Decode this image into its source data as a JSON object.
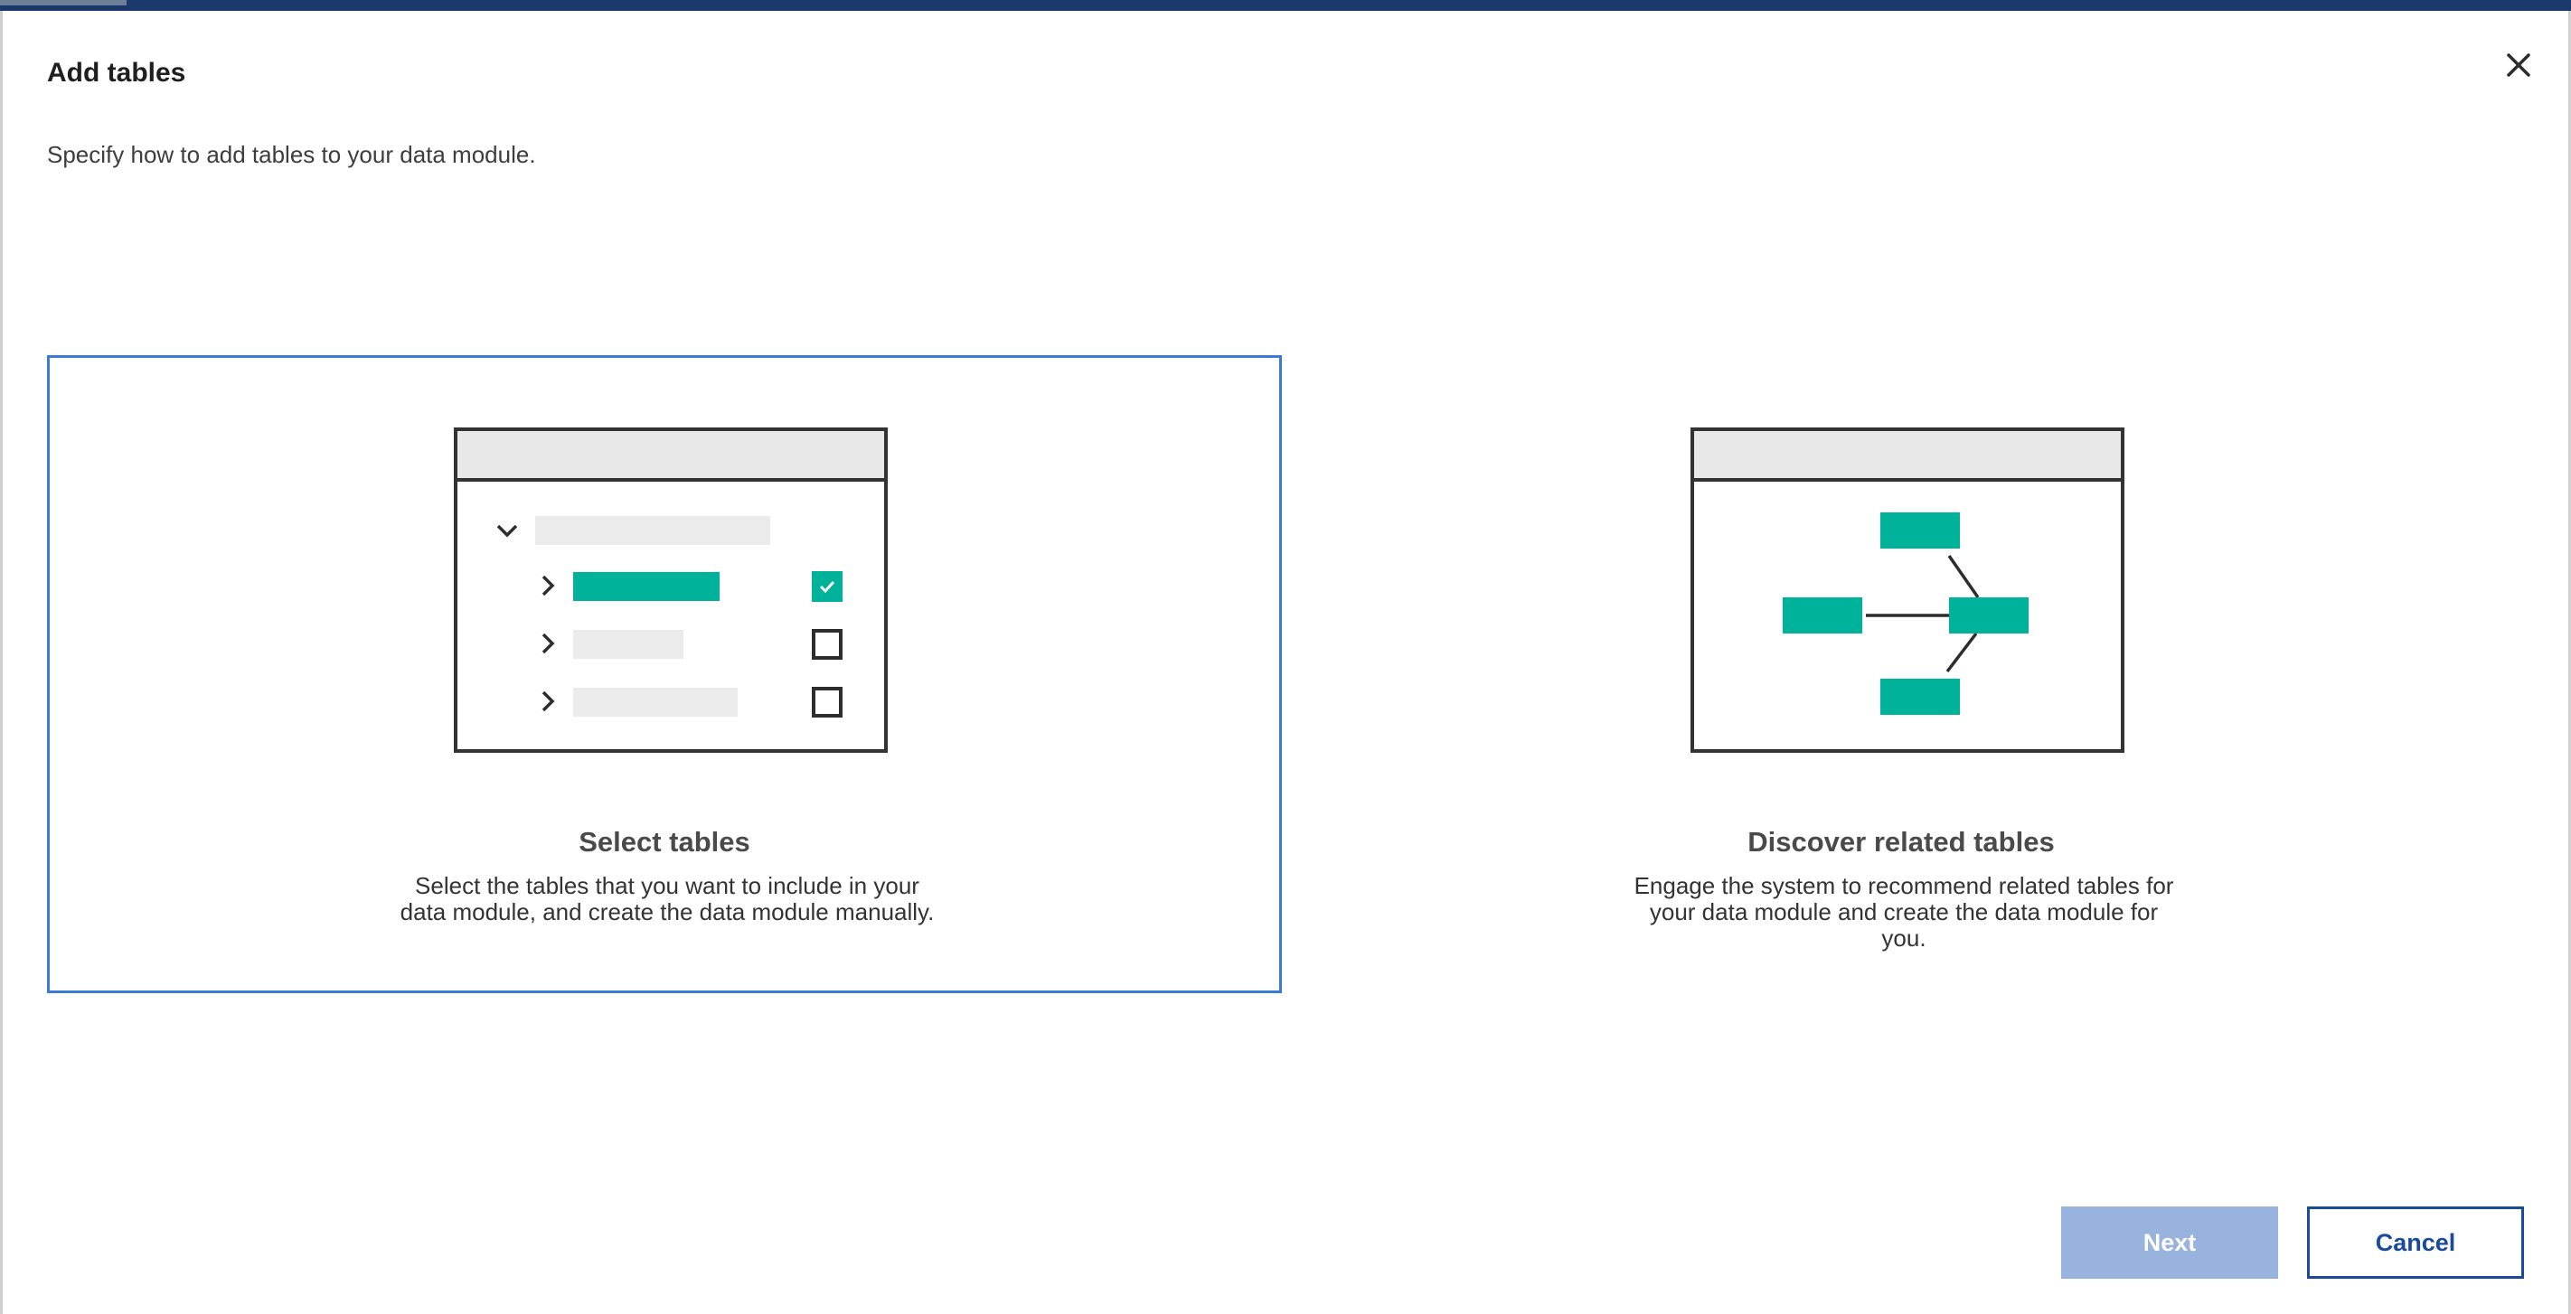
{
  "dialog": {
    "title": "Add tables",
    "subtitle": "Specify how to add tables to your data module.",
    "close_icon": "close-icon"
  },
  "options": [
    {
      "title": "Select tables",
      "description": "Select the tables that you want to include in your data module, and create the data module manually.",
      "selected": true,
      "illustration": "tree-checklist-illustration"
    },
    {
      "title": "Discover related tables",
      "description": "Engage the system to recommend related tables for your data module and create the data module for you.",
      "selected": false,
      "illustration": "relationship-graph-illustration"
    }
  ],
  "buttons": {
    "next_label": "Next",
    "next_enabled": false,
    "cancel_label": "Cancel"
  },
  "colors": {
    "accent": "#3a7bd5",
    "teal": "#00b29a",
    "primary_disabled": "#97b3de",
    "secondary": "#1a4a9c",
    "top_bar": "#1b3a6b"
  }
}
